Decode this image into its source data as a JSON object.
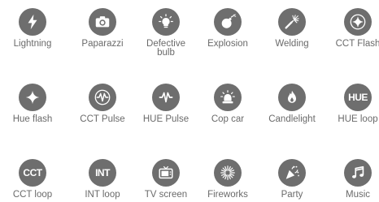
{
  "icon_color": "#6e6e6e",
  "label_color": "#6a6a6a",
  "effects": [
    {
      "label": "Lightning",
      "icon": "lightning-icon"
    },
    {
      "label": "Paparazzi",
      "icon": "camera-icon"
    },
    {
      "label": "Defective\nbulb",
      "icon": "lightbulb-icon"
    },
    {
      "label": "Explosion",
      "icon": "bomb-icon"
    },
    {
      "label": "Welding",
      "icon": "welding-torch-icon"
    },
    {
      "label": "CCT Flash",
      "icon": "sparkle-icon"
    },
    {
      "label": "Hue flash",
      "icon": "sparkle-icon"
    },
    {
      "label": "CCT Pulse",
      "icon": "pulse-wave-icon"
    },
    {
      "label": "HUE Pulse",
      "icon": "pulse-wave-icon"
    },
    {
      "label": "Cop car",
      "icon": "siren-icon"
    },
    {
      "label": "Candlelight",
      "icon": "flame-icon"
    },
    {
      "label": "HUE loop",
      "icon": "hue-text-icon",
      "icon_text": "HUE"
    },
    {
      "label": "CCT loop",
      "icon": "cct-text-icon",
      "icon_text": "CCT"
    },
    {
      "label": "INT loop",
      "icon": "int-text-icon",
      "icon_text": "INT"
    },
    {
      "label": "TV screen",
      "icon": "tv-icon"
    },
    {
      "label": "Fireworks",
      "icon": "fireworks-icon"
    },
    {
      "label": "Party",
      "icon": "party-popper-icon"
    },
    {
      "label": "Music",
      "icon": "music-note-icon"
    }
  ]
}
